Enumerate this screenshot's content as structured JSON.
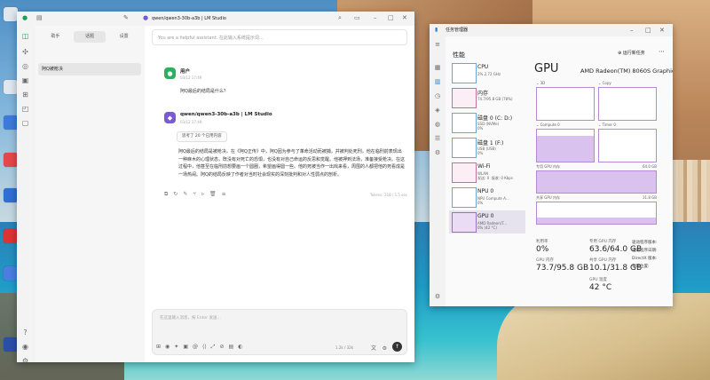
{
  "desktop": {
    "background_theme": "coastal-cliffs"
  },
  "lmstudio": {
    "window_title": "qwen/qwen3-30b-a3b | LM Studio",
    "tabs": [
      {
        "label": "助手"
      },
      {
        "label": "话题"
      },
      {
        "label": "设置"
      }
    ],
    "active_tab_index": 1,
    "sidebar_item": "阿Q被枪决",
    "system_prompt_placeholder": "You are a helpful assistant. 在此输入系统提示词…",
    "messages": [
      {
        "role": "user",
        "name": "用户",
        "time": "03/12 17:49",
        "text": "阿Q最后的结局是什么？"
      },
      {
        "role": "assistant",
        "name": "qwen/qwen3-30b-a3b | LM Studio",
        "time": "03/12 17:49",
        "thought_badge": "思考了 20 个已用内容",
        "text": "阿Q最后的结局是被枪决。在《阿Q正传》中，阿Q因为参与了革命活动而被捕，并被判处死刑。他在临刑前表现出一种麻木的心理状态，既没有对死亡的恐惧，也没有对自己命运的反思和觉醒。他被押到法场，准备接受枪决。在这过程中，他甚至在临刑前想要画一个圆圈，希望画得圆一些。他的死被当作一出戏来看，周围的人都把他的死看成是一场热闹。阿Q的结局反映了作者对当时社会现实的深刻批判和对人性弱点的剖析。",
        "footer": "Tokens: 218 / 1.5 sec"
      }
    ],
    "input_placeholder": "在这里输入消息，按 Enter 发送…",
    "token_count": "1.2k / 32k"
  },
  "taskmanager": {
    "window_title": "任务管理器",
    "section": "性能",
    "run_task_label": "运行新任务",
    "resources": [
      {
        "name": "CPU",
        "sub": "2%  2.72 GHz",
        "thumb": "blue"
      },
      {
        "name": "内存",
        "sub": "74.7/95.8 GB (78%)",
        "thumb": "pink"
      },
      {
        "name": "磁盘 0 (C: D:)",
        "sub": "SSD (NVMe)\n0%",
        "thumb": "blue"
      },
      {
        "name": "磁盘 1 (F:)",
        "sub": "USB (USB)\n0%",
        "thumb": "blue"
      },
      {
        "name": "Wi-Fi",
        "sub": "WLAN\n发送: 0  接收: 0 Kbps",
        "thumb": "pink"
      },
      {
        "name": "NPU 0",
        "sub": "NPU Compute A...\n0%",
        "thumb": "blue"
      },
      {
        "name": "GPU 0",
        "sub": "AMD Radeon(T...\n0% (42 °C)",
        "thumb": "purple"
      }
    ],
    "gpu": {
      "title": "GPU",
      "model": "AMD Radeon(TM) 8060S Graphics",
      "graphs": [
        {
          "label": "3D",
          "value_pct": 0
        },
        {
          "label": "Copy",
          "value_pct": 0
        },
        {
          "label": "Compute 0",
          "value_pct": 80
        },
        {
          "label": "Timer 0",
          "value_pct": 0
        }
      ],
      "shared_label": "专用 GPU 内存",
      "shared_max": "64.0 GB",
      "shared_fill_pct": 98,
      "shared2_label": "共享 GPU 内存",
      "shared2_max": "31.8 GB",
      "shared2_fill_pct": 30,
      "stats": {
        "util_label": "利用率",
        "util_value": "0%",
        "dedicated_label": "专用 GPU 内存",
        "dedicated_value": "63.6/64.0 GB",
        "gpu_mem_label": "GPU 内存",
        "gpu_mem_value": "73.7/95.8 GB",
        "shared_label": "共享 GPU 内存",
        "shared_value": "10.1/31.8 GB",
        "temp_label": "GPU 温度",
        "temp_value": "42 °C",
        "driver_label": "驱动程序版本:",
        "driver_date_label": "驱动程序日期:",
        "directx_label": "DirectX 版本:",
        "location_label": "物理位置:"
      }
    }
  }
}
